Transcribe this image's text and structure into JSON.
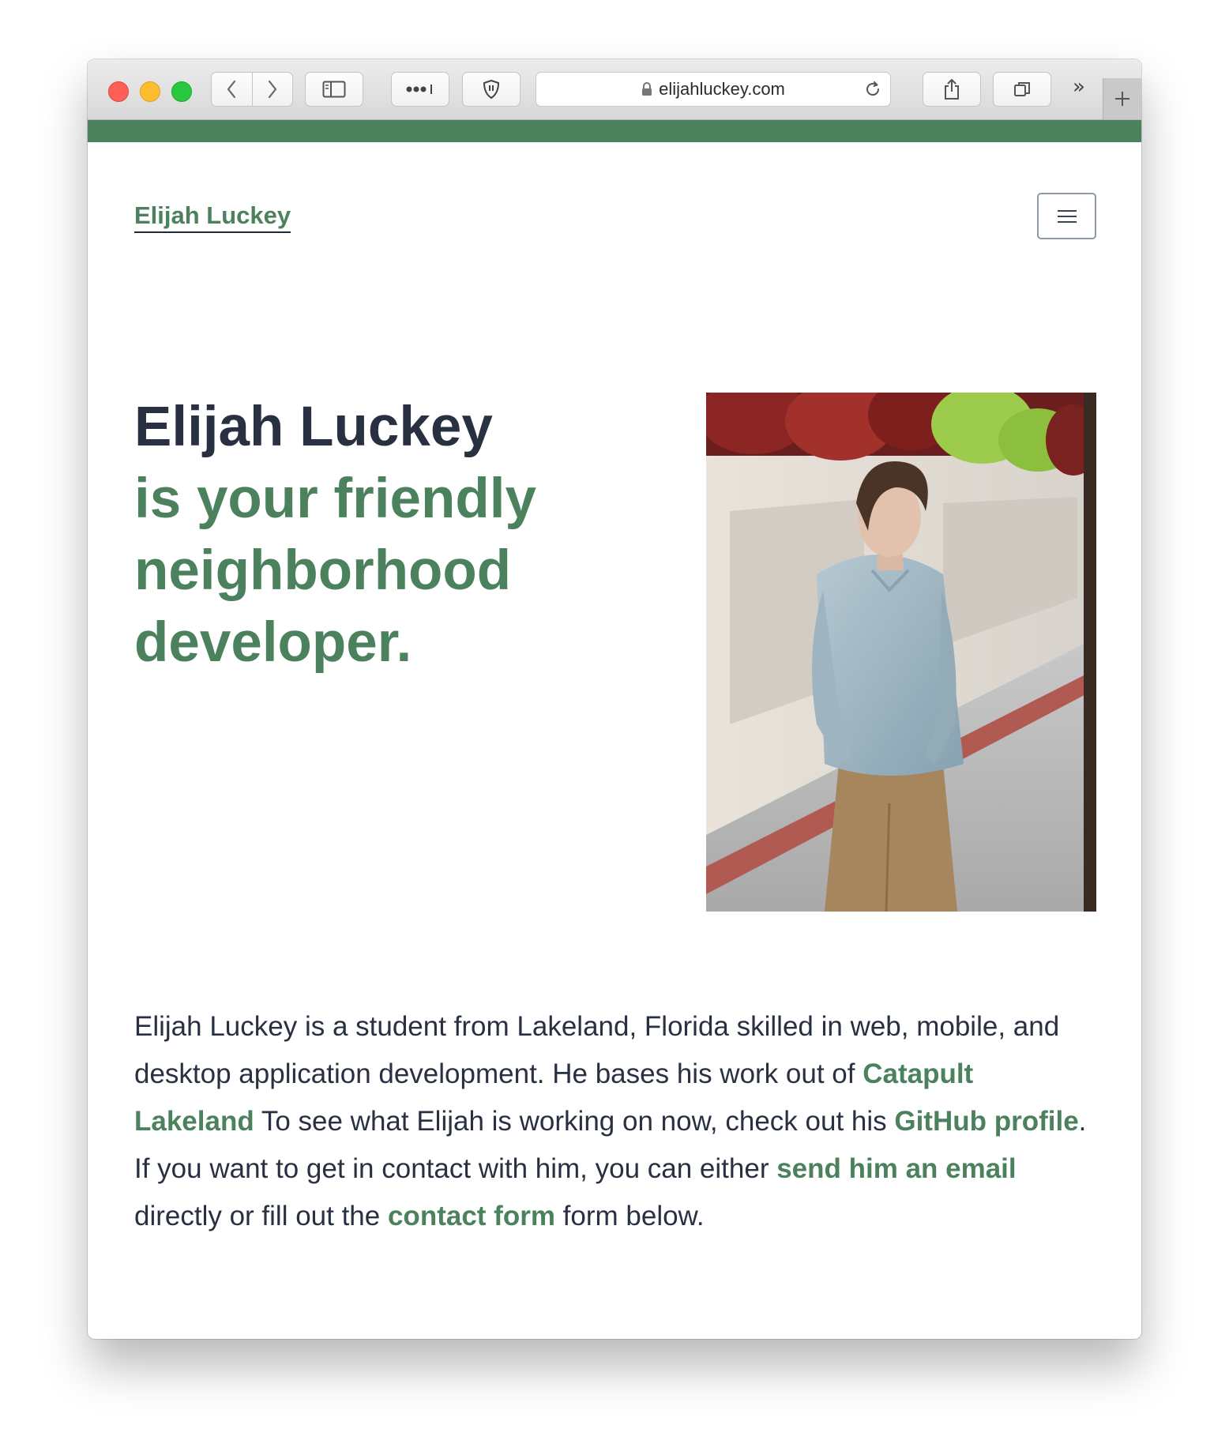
{
  "browser": {
    "url": "elijahluckey.com",
    "more_glyph": "»"
  },
  "site": {
    "name": "Elijah Luckey",
    "accent": "#4b825d",
    "text": "#283042"
  },
  "hero": {
    "name": "Elijah Luckey",
    "tagline_1": "is your friendly",
    "tagline_2": "neighborhood",
    "tagline_3": "developer."
  },
  "bio": {
    "p1": "Elijah Luckey is a student from Lakeland, Florida skilled in web, mobile, and desktop application development. He bases his work out of ",
    "link_catapult": "Catapult Lakeland",
    "p2": " To see what Elijah is working on now, check out his ",
    "link_github": "GitHub profile",
    "p3": ". If you want to get in contact with him, you can either ",
    "link_email": "send him an email",
    "p4": " directly or fill out the ",
    "link_contact": "contact form",
    "p5": " form below."
  },
  "icons": {
    "back": "chevron-left-icon",
    "forward": "chevron-right-icon",
    "sidebar": "sidebar-icon",
    "extensions": "more-dots-icon",
    "shield": "shield-icon",
    "lock": "lock-icon",
    "reload": "reload-icon",
    "share": "share-icon",
    "tabs": "tabs-icon",
    "new_tab": "plus-icon",
    "menu": "hamburger-menu-icon"
  }
}
